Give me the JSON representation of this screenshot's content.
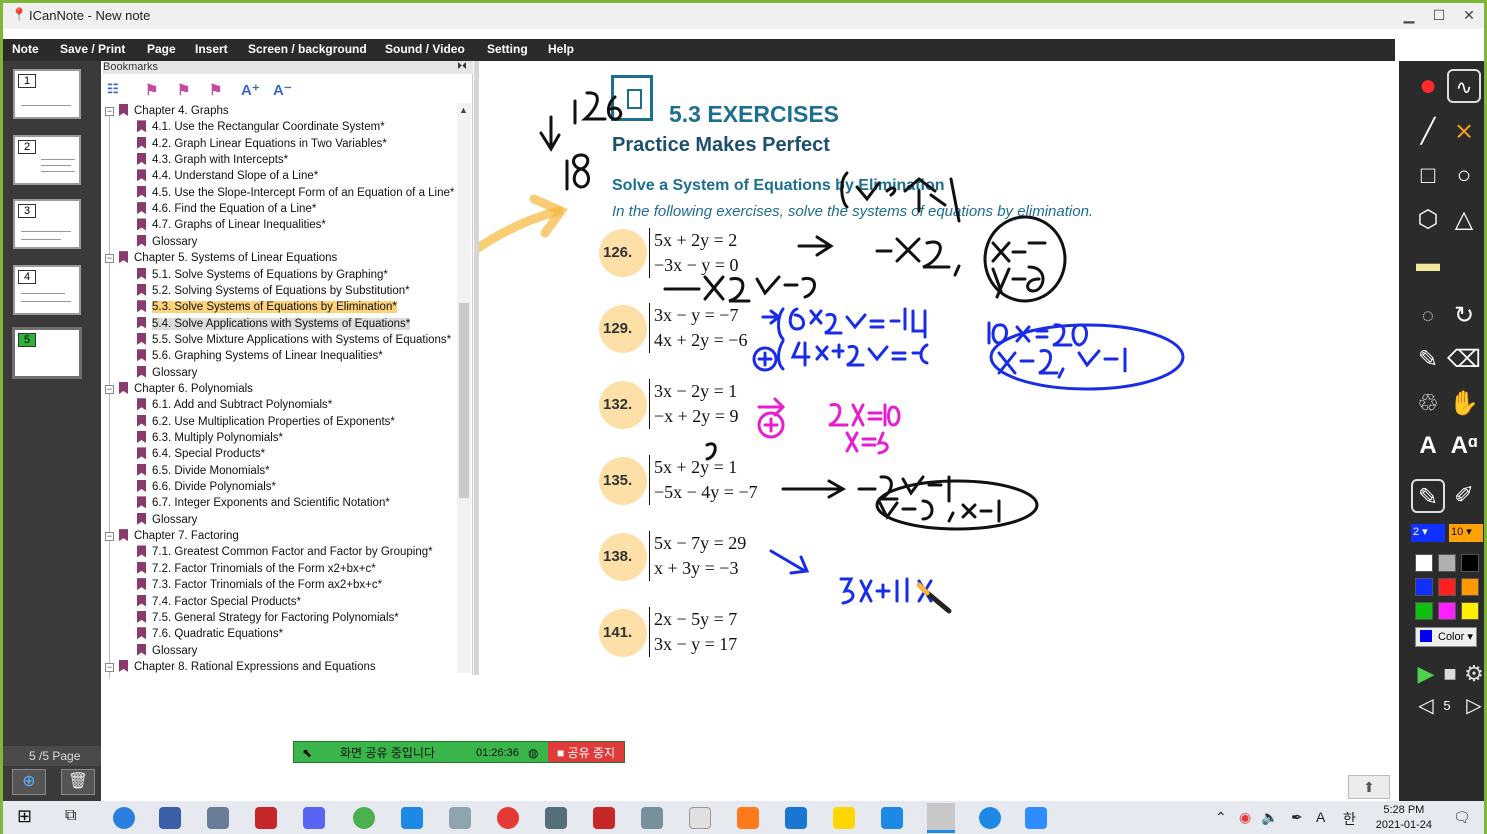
{
  "window": {
    "title": "ICanNote - New note"
  },
  "menu": [
    "Note",
    "Save / Print",
    "Page",
    "Insert",
    "Screen / background",
    "Sound / Video",
    "Setting",
    "Help"
  ],
  "pages": {
    "indicator": "5  /5 Page",
    "count": 5,
    "current": 5
  },
  "bookmarks": {
    "header": "Bookmarks",
    "items": [
      {
        "level": 0,
        "text": "Chapter 4. Graphs"
      },
      {
        "level": 1,
        "text": "4.1. Use the Rectangular Coordinate System*"
      },
      {
        "level": 1,
        "text": "4.2. Graph Linear Equations in Two Variables*"
      },
      {
        "level": 1,
        "text": "4.3. Graph with Intercepts*"
      },
      {
        "level": 1,
        "text": "4.4. Understand Slope of a Line*"
      },
      {
        "level": 1,
        "text": "4.5. Use the Slope-Intercept Form of an Equation of a Line*"
      },
      {
        "level": 1,
        "text": "4.6. Find the Equation of a Line*"
      },
      {
        "level": 1,
        "text": "4.7. Graphs of Linear Inequalities*"
      },
      {
        "level": 1,
        "text": "Glossary"
      },
      {
        "level": 0,
        "text": "Chapter 5. Systems of Linear Equations"
      },
      {
        "level": 1,
        "text": "5.1. Solve Systems of Equations by Graphing*"
      },
      {
        "level": 1,
        "text": "5.2. Solving Systems of Equations by Substitution*"
      },
      {
        "level": 1,
        "text": "5.3. Solve Systems of Equations by Elimination*",
        "state": "highlight"
      },
      {
        "level": 1,
        "text": "5.4. Solve Applications with Systems of Equations*",
        "state": "selected"
      },
      {
        "level": 1,
        "text": "5.5. Solve Mixture Applications with Systems of Equations*"
      },
      {
        "level": 1,
        "text": "5.6. Graphing Systems of Linear Inequalities*"
      },
      {
        "level": 1,
        "text": "Glossary"
      },
      {
        "level": 0,
        "text": "Chapter 6. Polynomials"
      },
      {
        "level": 1,
        "text": "6.1. Add and Subtract Polynomials*"
      },
      {
        "level": 1,
        "text": "6.2. Use Multiplication Properties of Exponents*"
      },
      {
        "level": 1,
        "text": "6.3. Multiply Polynomials*"
      },
      {
        "level": 1,
        "text": "6.4. Special Products*"
      },
      {
        "level": 1,
        "text": "6.5. Divide Monomials*"
      },
      {
        "level": 1,
        "text": "6.6. Divide Polynomials*"
      },
      {
        "level": 1,
        "text": "6.7. Integer Exponents and Scientific Notation*"
      },
      {
        "level": 1,
        "text": "Glossary"
      },
      {
        "level": 0,
        "text": "Chapter 7. Factoring"
      },
      {
        "level": 1,
        "text": "7.1. Greatest Common Factor and Factor by Grouping*"
      },
      {
        "level": 1,
        "text": "7.2. Factor Trinomials of the Form x2+bx+c*"
      },
      {
        "level": 1,
        "text": "7.3. Factor Trinomials of the Form ax2+bx+c*"
      },
      {
        "level": 1,
        "text": "7.4. Factor Special Products*"
      },
      {
        "level": 1,
        "text": "7.5. General Strategy for Factoring Polynomials*"
      },
      {
        "level": 1,
        "text": "7.6. Quadratic Equations*"
      },
      {
        "level": 1,
        "text": "Glossary"
      },
      {
        "level": 0,
        "text": "Chapter 8. Rational Expressions and Equations"
      }
    ]
  },
  "content": {
    "section": "5.3 EXERCISES",
    "heading": "Practice Makes Perfect",
    "subheading": "Solve a System of Equations by Elimination",
    "instruction": "In the following exercises, solve the systems of equations by elimination.",
    "problems": [
      {
        "num": "126.",
        "eq1": "5x + 2y = 2",
        "eq2": "−3x − y = 0"
      },
      {
        "num": "129.",
        "eq1": "3x − y = −7",
        "eq2": "4x + 2y = −6"
      },
      {
        "num": "132.",
        "eq1": "3x − 2y = 1",
        "eq2": "−x + 2y = 9"
      },
      {
        "num": "135.",
        "eq1": "5x + 2y = 1",
        "eq2": "−5x − 4y = −7"
      },
      {
        "num": "138.",
        "eq1": "5x − 7y = 29",
        "eq2": "x + 3y = −3"
      },
      {
        "num": "141.",
        "eq1": "2x − 5y = 7",
        "eq2": "3x − y = 17"
      }
    ]
  },
  "tools": {
    "pen_size": "2",
    "eraser_size": "10",
    "color_label": "Color",
    "page_nav": "5"
  },
  "swatches": [
    "#ffffff",
    "#b0b0b0",
    "#000000",
    "#1030ff",
    "#ff2020",
    "#ff9900",
    "#10c010",
    "#ff20ff",
    "#ffee00"
  ],
  "share": {
    "status": "화면 공유 중입니다",
    "timer": "01:26:36",
    "stop": "공유 중지"
  },
  "taskbar": {
    "time": "5:28 PM",
    "date": "2021-01-24"
  }
}
